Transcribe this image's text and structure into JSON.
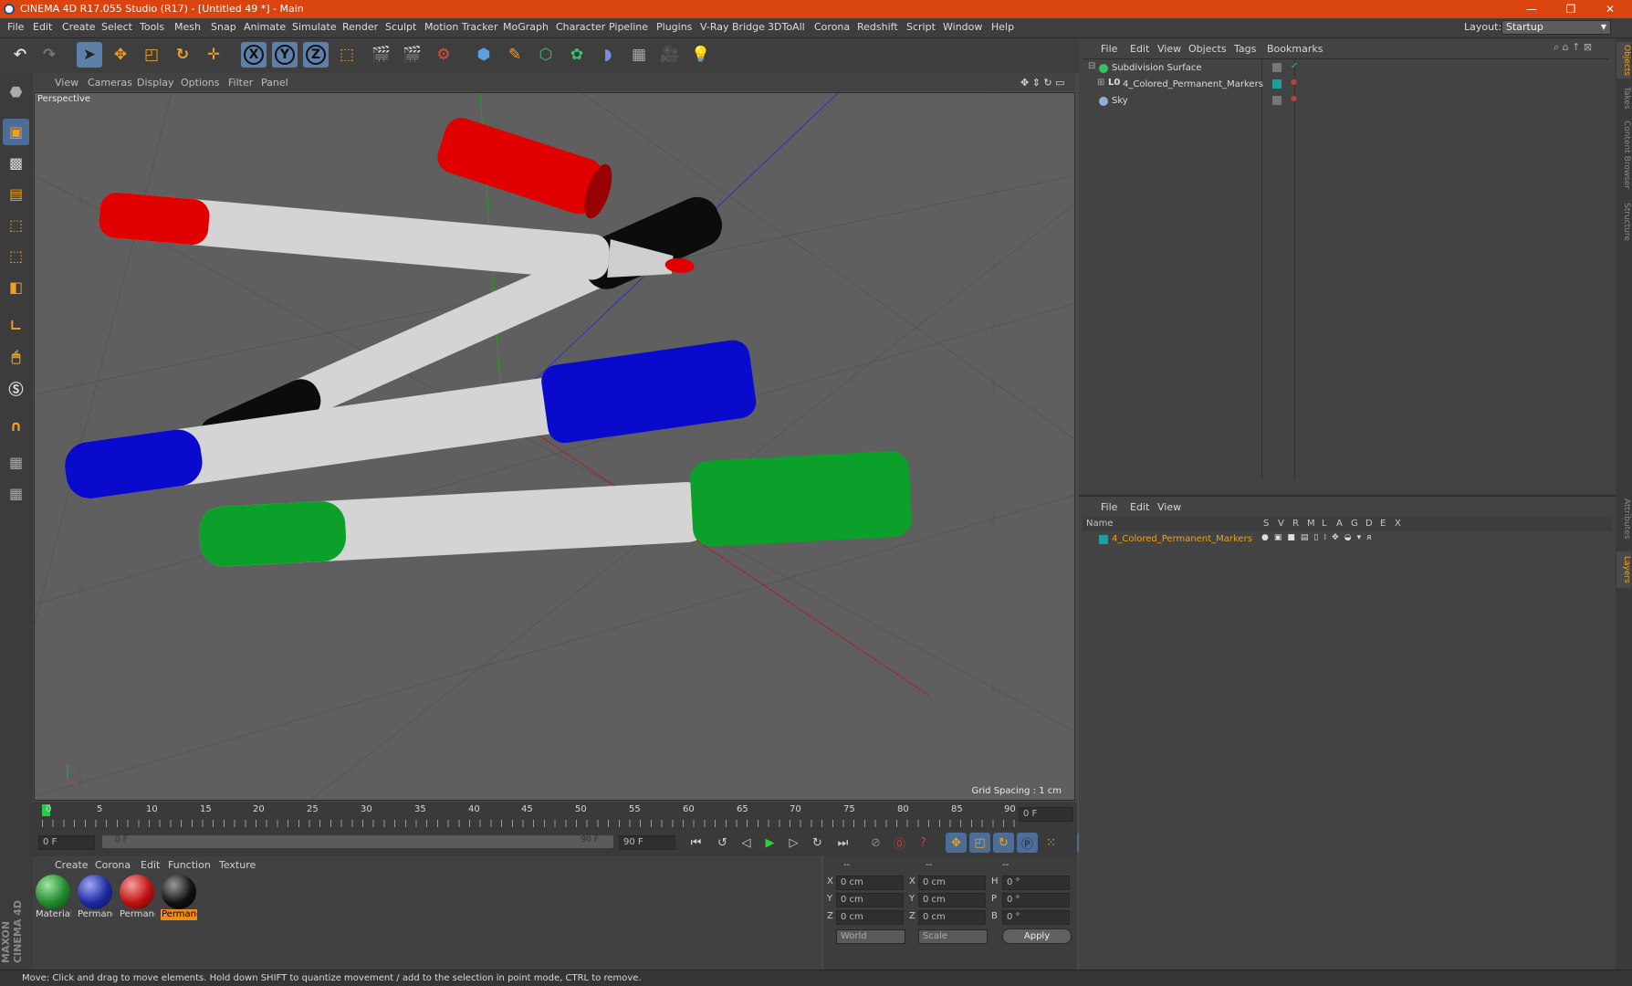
{
  "titlebar": {
    "title": "CINEMA 4D R17.055 Studio (R17) - [Untitled 49 *] - Main"
  },
  "menubar": {
    "items": [
      "File",
      "Edit",
      "Create",
      "Select",
      "Tools",
      "Mesh",
      "Snap",
      "Animate",
      "Simulate",
      "Render",
      "Sculpt",
      "Motion Tracker",
      "MoGraph",
      "Character",
      "Pipeline",
      "Plugins",
      "V-Ray Bridge",
      "3DToAll",
      "Corona",
      "Redshift",
      "Script",
      "Window",
      "Help"
    ],
    "layout_label": "Layout:",
    "layout_value": "Startup"
  },
  "toolbar": {
    "x_label": "X",
    "y_label": "Y",
    "z_label": "Z"
  },
  "viewport": {
    "menu": [
      "View",
      "Cameras",
      "Display",
      "Options",
      "Filter",
      "Panel"
    ],
    "label": "Perspective",
    "grid_spacing": "Grid Spacing : 1 cm",
    "marker_colors": {
      "red": "#e00000",
      "black": "#0c0c0c",
      "blue": "#0a0acd",
      "green": "#0aa02a",
      "body": "#d4d4d4"
    }
  },
  "timeline": {
    "ticks": [
      "0",
      "5",
      "10",
      "15",
      "20",
      "25",
      "30",
      "35",
      "40",
      "45",
      "50",
      "55",
      "60",
      "65",
      "70",
      "75",
      "80",
      "85",
      "90"
    ],
    "current_frame": "0 F"
  },
  "transport": {
    "start": "0 F",
    "slider_start": "0 F",
    "slider_end": "90 F",
    "end": "90 F"
  },
  "material_manager": {
    "menu": [
      "Create",
      "Corona",
      "Edit",
      "Function",
      "Texture"
    ],
    "materials": [
      {
        "label": "Material",
        "color": "#1f8a2a"
      },
      {
        "label": "Permane",
        "color": "#1a2aa0"
      },
      {
        "label": "Permane",
        "color": "#c01010"
      },
      {
        "label": "Permane",
        "color": "#111111"
      }
    ]
  },
  "coords": {
    "headers": [
      "--",
      "--",
      "--"
    ],
    "rows": [
      {
        "a": "X",
        "av": "0 cm",
        "b": "X",
        "bv": "0 cm",
        "c": "H",
        "cv": "0 °"
      },
      {
        "a": "Y",
        "av": "0 cm",
        "b": "Y",
        "bv": "0 cm",
        "c": "P",
        "cv": "0 °"
      },
      {
        "a": "Z",
        "av": "0 cm",
        "b": "Z",
        "bv": "0 cm",
        "c": "B",
        "cv": "0 °"
      }
    ],
    "world": "World",
    "scale": "Scale",
    "apply": "Apply"
  },
  "objects": {
    "menu": [
      "File",
      "Edit",
      "View",
      "Objects",
      "Tags",
      "Bookmarks"
    ],
    "items": [
      {
        "name": "Subdivision Surface"
      },
      {
        "name": "4_Colored_Permanent_Markers"
      },
      {
        "name": "Sky"
      }
    ]
  },
  "layers": {
    "menu": [
      "File",
      "Edit",
      "View"
    ],
    "name_header": "Name",
    "columns": [
      "S",
      "V",
      "R",
      "M",
      "L",
      "A",
      "G",
      "D",
      "E",
      "X"
    ],
    "items": [
      {
        "name": "4_Colored_Permanent_Markers"
      }
    ]
  },
  "sidetabs": [
    "Objects",
    "Takes",
    "Content Browser",
    "Structure",
    "Attributes",
    "Layers"
  ],
  "status": "Move: Click and drag to move elements. Hold down SHIFT to quantize movement / add to the selection in point mode, CTRL to remove.",
  "maxon": "MAXON CINEMA 4D"
}
